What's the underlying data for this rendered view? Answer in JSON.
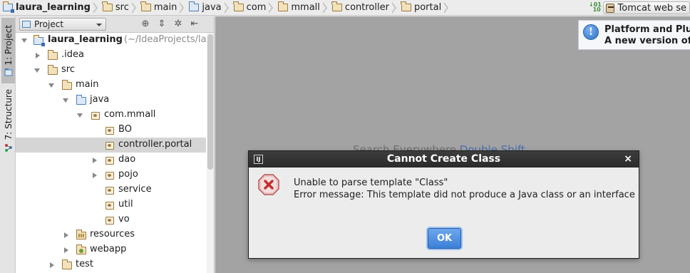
{
  "breadcrumb": {
    "items": [
      {
        "label": "laura_learning",
        "icon": "project-folder-icon"
      },
      {
        "label": "src",
        "icon": "folder-icon"
      },
      {
        "label": "main",
        "icon": "folder-icon"
      },
      {
        "label": "java",
        "icon": "source-folder-icon"
      },
      {
        "label": "com",
        "icon": "folder-icon"
      },
      {
        "label": "mmall",
        "icon": "folder-icon"
      },
      {
        "label": "controller",
        "icon": "folder-icon"
      },
      {
        "label": "portal",
        "icon": "folder-icon"
      }
    ]
  },
  "toolbar": {
    "run_config_label": "Tomcat web se",
    "sort_icon": "sort-0-1-icon"
  },
  "tool_strip": {
    "project_tab": "1: Project",
    "structure_tab": "7: Structure"
  },
  "project_panel": {
    "view_selector": "Project",
    "tree": [
      {
        "label": "laura_learning",
        "suffix": "(~/IdeaProjects/la",
        "bold": true,
        "expanded": true,
        "icon": "project-folder-icon"
      },
      {
        "label": ".idea",
        "expanded": false,
        "icon": "folder-icon"
      },
      {
        "label": "src",
        "expanded": true,
        "icon": "folder-icon"
      },
      {
        "label": "main",
        "expanded": true,
        "icon": "folder-icon"
      },
      {
        "label": "java",
        "expanded": true,
        "icon": "source-folder-icon"
      },
      {
        "label": "com.mmall",
        "expanded": true,
        "icon": "package-icon"
      },
      {
        "label": "BO",
        "icon": "package-icon"
      },
      {
        "label": "controller.portal",
        "selected": true,
        "icon": "package-icon"
      },
      {
        "label": "dao",
        "expanded": false,
        "icon": "package-icon"
      },
      {
        "label": "pojo",
        "expanded": false,
        "icon": "package-icon"
      },
      {
        "label": "service",
        "icon": "package-icon"
      },
      {
        "label": "util",
        "icon": "package-icon"
      },
      {
        "label": "vo",
        "icon": "package-icon"
      },
      {
        "label": "resources",
        "expanded": false,
        "icon": "resources-folder-icon"
      },
      {
        "label": "webapp",
        "expanded": false,
        "icon": "web-folder-icon"
      },
      {
        "label": "test",
        "expanded": false,
        "icon": "folder-icon"
      }
    ]
  },
  "editor": {
    "hint_text": "Search Everywhere",
    "hint_shortcut": "Double Shift"
  },
  "notification": {
    "line1": "Platform and Plu",
    "line2": "A new version of"
  },
  "dialog": {
    "title": "Cannot Create Class",
    "message_line1": "Unable to parse template \"Class\"",
    "message_line2": "Error message: This template did not produce a Java class or an interface",
    "ok_label": "OK",
    "close_symbol": "×",
    "badge": "IJ"
  },
  "colors": {
    "editor_bg": "#a3a3a3",
    "dialog_title_bg": "#333333",
    "ok_button": "#4a8ae0",
    "error_icon": "#d33a3a",
    "selection": "#d5d5d5"
  }
}
